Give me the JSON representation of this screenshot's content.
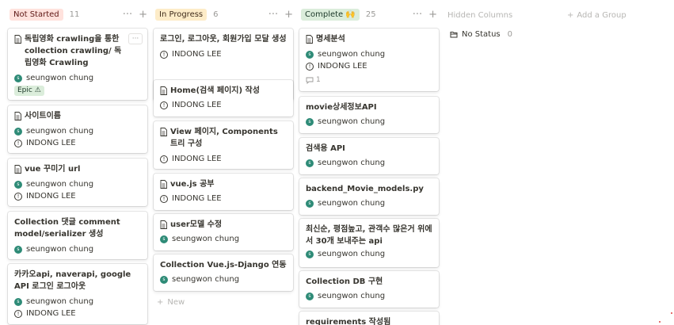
{
  "columns": [
    {
      "status": "Not Started",
      "count": "11",
      "tag_bg": "#ffe2dd",
      "tag_fg": "#5d1715",
      "cards": [
        {
          "title": "독립영화 crawling을 통한 collection crawling/ 독립영화 Crawling",
          "assignee": "seungwon chung",
          "epic": "Epic ⚠"
        },
        {
          "title": "사이트이름",
          "assignee": "seungwon chung",
          "reviewer": "INDONG LEE"
        },
        {
          "title": "vue 꾸미기 url",
          "assignee": "seungwon chung",
          "reviewer": "INDONG LEE"
        },
        {
          "title": "Collection 댓글 comment model/serializer 생성",
          "assignee": "seungwon chung"
        },
        {
          "title": "카카오api, naverapi, google API 로그인 로그아웃",
          "assignee": "seungwon chung",
          "reviewer": "INDONG LEE"
        }
      ]
    },
    {
      "status": "In Progress",
      "count": "6",
      "tag_bg": "#fdecc8",
      "tag_fg": "#402c1b",
      "cards": [
        {
          "title": "로그인, 로그아웃, 회원가입 모달 생성",
          "reviewer": "INDONG LEE"
        },
        {
          "title": "Home(검색 페이지) 작성",
          "reviewer": "INDONG LEE"
        },
        {
          "title": "View 페이지, Components 트리 구성",
          "reviewer": "INDONG LEE"
        },
        {
          "title": "vue.js 공부",
          "reviewer": "INDONG LEE"
        },
        {
          "title": "user모델 수정",
          "assignee": "seungwon chung"
        },
        {
          "title": "Collection Vue.js-Django 연동",
          "assignee": "seungwon chung"
        }
      ],
      "new_label": "New"
    },
    {
      "status": "Complete 🙌",
      "count": "25",
      "tag_bg": "#dbeddb",
      "tag_fg": "#1c3829",
      "cards": [
        {
          "title": "명세분석",
          "assignee": "seungwon chung",
          "reviewer": "INDONG LEE",
          "comments": "1"
        },
        {
          "title": "movie상세정보API",
          "assignee": "seungwon chung"
        },
        {
          "title": "검색용 API",
          "assignee": "seungwon chung"
        },
        {
          "title": "backend_Movie_models.py",
          "assignee": "seungwon chung"
        },
        {
          "title": "최신순, 평점높고, 관객수 많은거 위에서 30개 보내주는 api",
          "assignee": "seungwon chung"
        },
        {
          "title": "Collection DB 구현",
          "assignee": "seungwon chung"
        },
        {
          "title": "requirements 작성됨"
        }
      ]
    }
  ],
  "hidden_columns_label": "Hidden Columns",
  "no_status": {
    "label": "No Status",
    "count": "0"
  },
  "add_group_label": "Add a Group",
  "icons": {
    "more": "more-horizontal-icon",
    "add": "plus-icon",
    "doc": "page-icon",
    "reviewer": "info-icon",
    "comment": "comment-icon",
    "no_status": "folder-icon"
  }
}
